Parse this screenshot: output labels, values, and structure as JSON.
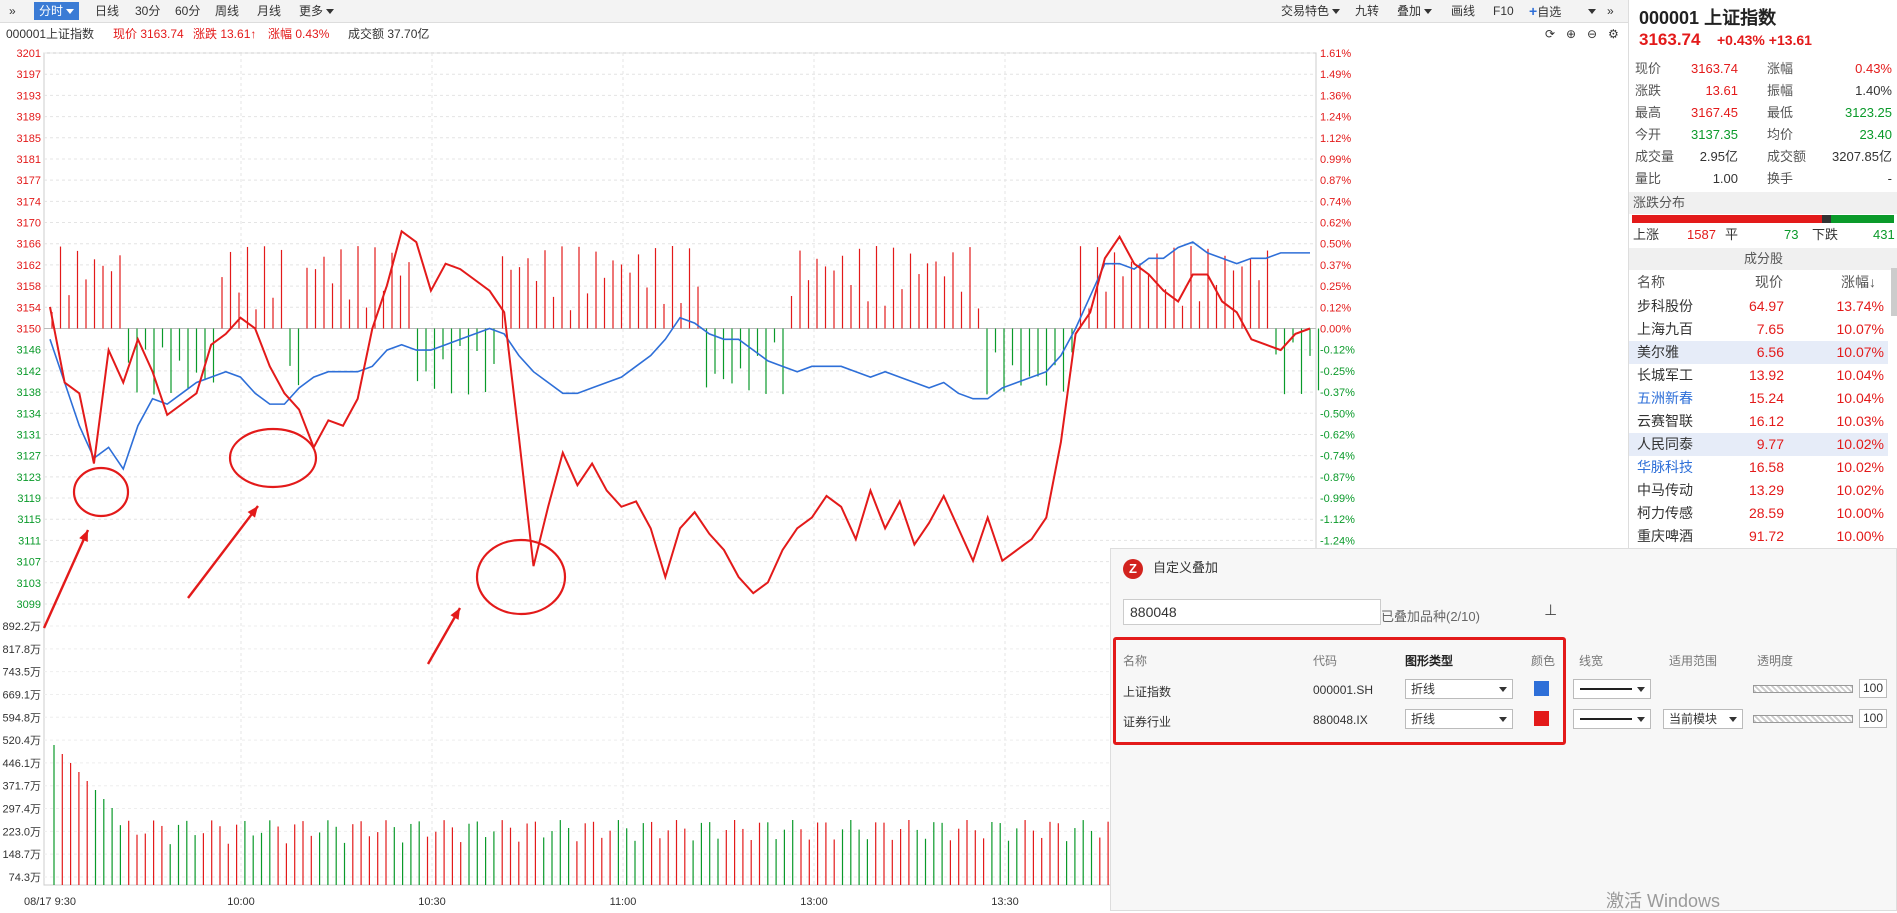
{
  "toolbar": {
    "left": [
      {
        "label": "分时",
        "active": true
      },
      {
        "label": "日线"
      },
      {
        "label": "30分"
      },
      {
        "label": "60分"
      },
      {
        "label": "周线"
      },
      {
        "label": "月线"
      },
      {
        "label": "更多"
      }
    ],
    "right": [
      {
        "label": "交易特色"
      },
      {
        "label": "九转"
      },
      {
        "label": "叠加"
      },
      {
        "label": "画线"
      },
      {
        "label": "F10"
      },
      {
        "label": "自选"
      }
    ]
  },
  "info": {
    "name": "000001上证指数",
    "price": "现价 3163.74",
    "change": "涨跌 13.61↑",
    "pct": "涨幅 0.43%",
    "turnover": "成交额 37.70亿"
  },
  "colors": {
    "up": "#e31a1a",
    "down": "#0a9a2a",
    "index_line": "#2e6fd8",
    "industry_line": "#e31a1a",
    "annotation": "#e31a1a"
  },
  "chart_data": {
    "type": "line",
    "title": "",
    "x_ticks": [
      "08/17 9:30",
      "10:00",
      "10:30",
      "11:00",
      "13:00",
      "13:30"
    ],
    "y_left_ticks": [
      "3201",
      "3197",
      "3193",
      "3189",
      "3185",
      "3181",
      "3177",
      "3174",
      "3170",
      "3166",
      "3162",
      "3158",
      "3154",
      "3150",
      "3146",
      "3142",
      "3138",
      "3134",
      "3131",
      "3127",
      "3123",
      "3119",
      "3115",
      "3111",
      "3107",
      "3103",
      "3099"
    ],
    "y_right_ticks": [
      "1.61%",
      "1.49%",
      "1.36%",
      "1.24%",
      "1.12%",
      "0.99%",
      "0.87%",
      "0.74%",
      "0.62%",
      "0.50%",
      "0.37%",
      "0.25%",
      "0.12%",
      "0.00%",
      "-0.12%",
      "-0.25%",
      "-0.37%",
      "-0.50%",
      "-0.62%",
      "-0.74%",
      "-0.87%",
      "-0.99%",
      "-1.12%",
      "-1.24%"
    ],
    "vol_ticks": [
      "892.2万",
      "817.8万",
      "743.5万",
      "669.1万",
      "594.8万",
      "520.4万",
      "446.1万",
      "371.7万",
      "297.4万",
      "223.0万",
      "148.7万",
      "74.3万"
    ],
    "ylim": [
      3099,
      3201
    ],
    "base": 3150,
    "series": [
      {
        "name": "上证指数",
        "values": [
          3148,
          3140,
          3132,
          3126,
          3128,
          3124,
          3132,
          3137,
          3136,
          3138,
          3140,
          3141,
          3142,
          3141,
          3138,
          3136,
          3136,
          3139,
          3141,
          3142,
          3142,
          3142,
          3143,
          3146,
          3147,
          3146,
          3146,
          3147,
          3148,
          3149,
          3150,
          3149,
          3145,
          3142,
          3140,
          3138,
          3138,
          3139,
          3140,
          3141,
          3143,
          3145,
          3148,
          3152,
          3151,
          3149,
          3148,
          3148,
          3146,
          3144,
          3143,
          3142,
          3143,
          3143,
          3143,
          3142,
          3141,
          3142,
          3141,
          3140,
          3139,
          3140,
          3138,
          3137,
          3137,
          3139,
          3140,
          3141,
          3142,
          3145,
          3150,
          3156,
          3162,
          3162,
          3161,
          3163,
          3163,
          3165,
          3166,
          3164,
          3163,
          3162,
          3163,
          3163,
          3164,
          3164,
          3164
        ]
      },
      {
        "name": "证券行业",
        "values": [
          3154,
          3140,
          3138,
          3125,
          3146,
          3140,
          3148,
          3142,
          3134,
          3136,
          3138,
          3147,
          3149,
          3152,
          3150,
          3143,
          3138,
          3135,
          3128,
          3133,
          3132,
          3137,
          3150,
          3158,
          3168,
          3166,
          3157,
          3162,
          3161,
          3159,
          3157,
          3153,
          3130,
          3106,
          3117,
          3127,
          3121,
          3125,
          3120,
          3117,
          3118,
          3113,
          3104,
          3113,
          3116,
          3112,
          3109,
          3104,
          3101,
          3103,
          3109,
          3113,
          3115,
          3119,
          3117,
          3111,
          3120,
          3113,
          3118,
          3110,
          3114,
          3119,
          3113,
          3107,
          3115,
          3107,
          3109,
          3111,
          3115,
          3129,
          3149,
          3153,
          3163,
          3167,
          3162,
          3160,
          3157,
          3155,
          3160,
          3160,
          3155,
          3153,
          3148,
          3147,
          3146,
          3149,
          3150
        ]
      }
    ]
  },
  "panel": {
    "title": "000001 上证指数",
    "price": "3163.74",
    "change": "+0.43% +13.61",
    "quotes": [
      [
        "现价",
        "3163.74",
        "涨幅",
        "0.43%",
        "r",
        "r"
      ],
      [
        "涨跌",
        "13.61",
        "振幅",
        "1.40%",
        "r",
        "k"
      ],
      [
        "最高",
        "3167.45",
        "最低",
        "3123.25",
        "r",
        "g"
      ],
      [
        "今开",
        "3137.35",
        "均价",
        "23.40",
        "g",
        "g"
      ],
      [
        "成交量",
        "2.95亿",
        "成交额",
        "3207.85亿",
        "k",
        "k"
      ],
      [
        "量比",
        "1.00",
        "换手",
        "-",
        "k",
        "k"
      ]
    ],
    "dist_title": "涨跌分布",
    "dist": {
      "up_label": "上涨",
      "up": "1587",
      "flat_label": "平",
      "flat": "73",
      "down_label": "下跌",
      "down": "431"
    },
    "cons_title": "成分股",
    "cons_headers": [
      "名称",
      "现价",
      "涨幅↓"
    ],
    "cons": [
      [
        "步科股份",
        "64.97",
        "13.74%",
        "k",
        false
      ],
      [
        "上海九百",
        "7.65",
        "10.07%",
        "k",
        false
      ],
      [
        "美尔雅",
        "6.56",
        "10.07%",
        "k",
        true
      ],
      [
        "长城军工",
        "13.92",
        "10.04%",
        "k",
        false
      ],
      [
        "五洲新春",
        "15.24",
        "10.04%",
        "b",
        false
      ],
      [
        "云赛智联",
        "16.12",
        "10.03%",
        "k",
        false
      ],
      [
        "人民同泰",
        "9.77",
        "10.02%",
        "k",
        true
      ],
      [
        "华脉科技",
        "16.58",
        "10.02%",
        "b",
        false
      ],
      [
        "中马传动",
        "13.29",
        "10.02%",
        "k",
        false
      ],
      [
        "柯力传感",
        "28.59",
        "10.00%",
        "k",
        false
      ],
      [
        "重庆啤酒",
        "91.72",
        "10.00%",
        "k",
        false
      ]
    ]
  },
  "dialog": {
    "title": "自定义叠加",
    "input_value": "880048",
    "count_label": "已叠加品种(2/10)",
    "headers": [
      "名称",
      "代码",
      "图形类型",
      "颜色",
      "线宽",
      "适用范围",
      "透明度"
    ],
    "rows": [
      {
        "name": "上证指数",
        "code": "000001.SH",
        "type": "折线",
        "color": "#2e6fd8",
        "scope": "",
        "opacity": "100"
      },
      {
        "name": "证券行业",
        "code": "880048.IX",
        "type": "折线",
        "color": "#e31a1a",
        "scope": "当前模块",
        "opacity": "100"
      }
    ]
  },
  "watermark": "激活 Windows"
}
